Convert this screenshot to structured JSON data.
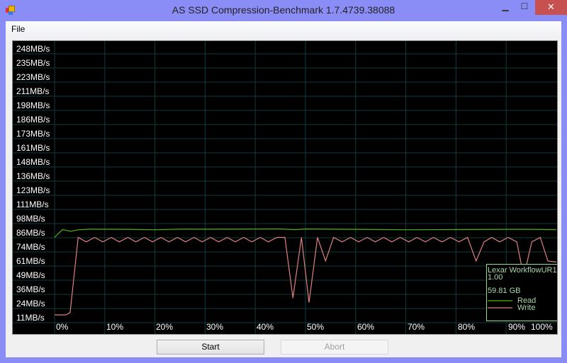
{
  "window": {
    "title": "AS SSD Compression-Benchmark 1.7.4739.38088",
    "minimize": "▁",
    "maximize": "☐",
    "close": "✕"
  },
  "menu": {
    "file": "File"
  },
  "buttons": {
    "start": "Start",
    "abort": "Abort",
    "abort_enabled": false
  },
  "colors": {
    "read": "#4fb800",
    "write": "#e08080",
    "grid": "#0d3b3b",
    "legend_border": "#90e090",
    "legend_text": "#a8d8a8",
    "label": "#ffffff"
  },
  "chart_data": {
    "type": "line",
    "title": "",
    "xlabel": "",
    "ylabel": "",
    "x_ticks": [
      "0%",
      "10%",
      "20%",
      "30%",
      "40%",
      "50%",
      "60%",
      "70%",
      "80%",
      "90%",
      "100%"
    ],
    "y_ticks": [
      "248MB/s",
      "235MB/s",
      "223MB/s",
      "211MB/s",
      "198MB/s",
      "186MB/s",
      "173MB/s",
      "161MB/s",
      "148MB/s",
      "136MB/s",
      "123MB/s",
      "111MB/s",
      "98MB/s",
      "86MB/s",
      "74MB/s",
      "61MB/s",
      "49MB/s",
      "36MB/s",
      "24MB/s",
      "11MB/s"
    ],
    "xlim": [
      0,
      100
    ],
    "ylim": [
      11,
      248
    ],
    "grid": true,
    "legend": {
      "placement": "bottom-right",
      "device": "Lexar WorkflowUR1",
      "firmware": "1.00",
      "capacity": "59.81 GB",
      "entries": [
        "Read",
        "Write"
      ]
    },
    "series": [
      {
        "name": "Read",
        "points": [
          [
            0,
            80
          ],
          [
            1.6,
            87
          ],
          [
            3.2,
            85.5
          ],
          [
            4.8,
            86.8
          ],
          [
            7,
            87.3
          ],
          [
            15,
            87.2
          ],
          [
            20,
            86.8
          ],
          [
            25,
            87.3
          ],
          [
            35,
            87.3
          ],
          [
            45,
            87.5
          ],
          [
            48,
            86.9
          ],
          [
            50,
            87.5
          ],
          [
            60,
            87.2
          ],
          [
            70,
            86.8
          ],
          [
            80,
            87
          ],
          [
            90,
            87.2
          ],
          [
            95,
            87.2
          ],
          [
            100,
            86.9
          ]
        ]
      },
      {
        "name": "Write",
        "points": [
          [
            0,
            11
          ],
          [
            2.2,
            11
          ],
          [
            3.1,
            13
          ],
          [
            4.7,
            80
          ],
          [
            6.3,
            76
          ],
          [
            8.0,
            80
          ],
          [
            9.6,
            76
          ],
          [
            11.3,
            80
          ],
          [
            12.9,
            76
          ],
          [
            14.6,
            80
          ],
          [
            16.2,
            76
          ],
          [
            17.9,
            80
          ],
          [
            19.5,
            76
          ],
          [
            21.2,
            80
          ],
          [
            22.8,
            76
          ],
          [
            24.5,
            80
          ],
          [
            26.1,
            76
          ],
          [
            27.8,
            80
          ],
          [
            29.4,
            76
          ],
          [
            31.1,
            80
          ],
          [
            32.7,
            76
          ],
          [
            34.4,
            80
          ],
          [
            36.0,
            76
          ],
          [
            37.7,
            80
          ],
          [
            39.3,
            76
          ],
          [
            41.0,
            80
          ],
          [
            42.6,
            76
          ],
          [
            44.3,
            80
          ],
          [
            45.9,
            80
          ],
          [
            47.5,
            26
          ],
          [
            49.2,
            80
          ],
          [
            50.7,
            22
          ],
          [
            52.4,
            80
          ],
          [
            54.0,
            59
          ],
          [
            55.6,
            80
          ],
          [
            57.3,
            76
          ],
          [
            59.0,
            80
          ],
          [
            60.6,
            76
          ],
          [
            62.3,
            80
          ],
          [
            63.9,
            76
          ],
          [
            65.6,
            80
          ],
          [
            67.2,
            76
          ],
          [
            68.9,
            80
          ],
          [
            70.6,
            76
          ],
          [
            72.2,
            80
          ],
          [
            73.9,
            76
          ],
          [
            75.5,
            80
          ],
          [
            77.2,
            76
          ],
          [
            78.9,
            80
          ],
          [
            80.6,
            76
          ],
          [
            82.3,
            80
          ],
          [
            84.0,
            59
          ],
          [
            85.6,
            76
          ],
          [
            87.1,
            80
          ],
          [
            88.7,
            76
          ],
          [
            90.4,
            80
          ],
          [
            92.1,
            76
          ],
          [
            93.5,
            45
          ],
          [
            95.1,
            76
          ],
          [
            96.8,
            80
          ],
          [
            98.3,
            59
          ],
          [
            100,
            58
          ]
        ]
      }
    ]
  }
}
